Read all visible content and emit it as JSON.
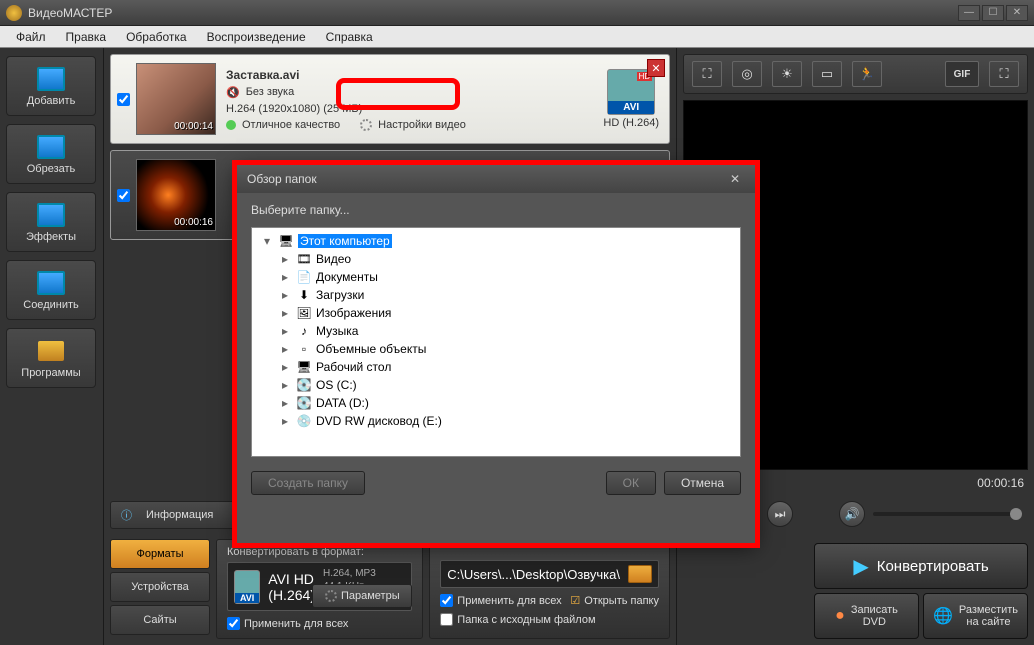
{
  "title": "ВидеоМАСТЕР",
  "menu": [
    "Файл",
    "Правка",
    "Обработка",
    "Воспроизведение",
    "Справка"
  ],
  "left_tools": [
    {
      "label": "Добавить",
      "name": "add-button"
    },
    {
      "label": "Обрезать",
      "name": "cut-button"
    },
    {
      "label": "Эффекты",
      "name": "effects-button"
    },
    {
      "label": "Соединить",
      "name": "join-button"
    },
    {
      "label": "Программы",
      "name": "programs-button"
    }
  ],
  "videos": [
    {
      "title": "Заставка.avi",
      "audio": "Без звука",
      "codec": "H.264 (1920x1080) (25 МБ)",
      "quality": "Отличное качество",
      "settings": "Настройки видео",
      "time": "00:00:14",
      "format_tag": "AVI",
      "format_label": "HD (H.264)",
      "hd": "HD"
    },
    {
      "title": "",
      "time": "00:00:16"
    }
  ],
  "info_bar": {
    "info": "Информация"
  },
  "tabs": [
    {
      "label": "Форматы",
      "active": true
    },
    {
      "label": "Устройства",
      "active": false
    },
    {
      "label": "Сайты",
      "active": false
    }
  ],
  "format_panel": {
    "header": "Конвертировать в формат:",
    "format_name": "AVI HD (H.264)",
    "codec_line1": "H.264, MP3",
    "codec_line2": "44,1 KHz, 256Кбит",
    "apply_all": "Применить для всех",
    "params": "Параметры"
  },
  "output_panel": {
    "path": "C:\\Users\\...\\Desktop\\Озвучка\\",
    "apply_all": "Применить для всех",
    "keep_source": "Папка с исходным файлом",
    "open_folder": "Открыть папку"
  },
  "actions": {
    "convert": "Конвертировать",
    "write_dvd_l1": "Записать",
    "write_dvd_l2": "DVD",
    "publish_l1": "Разместить",
    "publish_l2": "на сайте"
  },
  "preview": {
    "time": "00:00:16",
    "gif": "GIF"
  },
  "dialog": {
    "title": "Обзор папок",
    "subtitle": "Выберите папку...",
    "tree": [
      {
        "label": "Этот компьютер",
        "selected": true,
        "indent": 0,
        "icon": "🖥",
        "tri": "▾"
      },
      {
        "label": "Видео",
        "indent": 1,
        "icon": "🎞",
        "tri": "▸"
      },
      {
        "label": "Документы",
        "indent": 1,
        "icon": "📄",
        "tri": "▸"
      },
      {
        "label": "Загрузки",
        "indent": 1,
        "icon": "⬇",
        "tri": "▸"
      },
      {
        "label": "Изображения",
        "indent": 1,
        "icon": "🖼",
        "tri": "▸"
      },
      {
        "label": "Музыка",
        "indent": 1,
        "icon": "♪",
        "tri": "▸"
      },
      {
        "label": "Объемные объекты",
        "indent": 1,
        "icon": "▫",
        "tri": "▸"
      },
      {
        "label": "Рабочий стол",
        "indent": 1,
        "icon": "🖥",
        "tri": "▸"
      },
      {
        "label": "OS (C:)",
        "indent": 1,
        "icon": "💽",
        "tri": "▸"
      },
      {
        "label": "DATA (D:)",
        "indent": 1,
        "icon": "💽",
        "tri": "▸"
      },
      {
        "label": "DVD RW дисковод (E:)",
        "indent": 1,
        "icon": "💿",
        "tri": "▸"
      }
    ],
    "create": "Создать папку",
    "ok": "ОК",
    "cancel": "Отмена"
  }
}
